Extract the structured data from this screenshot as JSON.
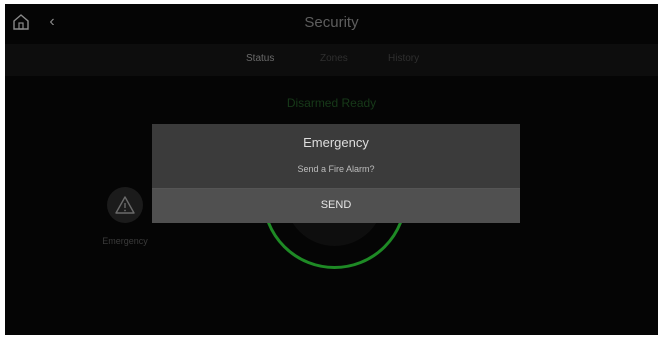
{
  "header": {
    "title": "Security",
    "home_icon": "home-icon",
    "back_icon": "chevron-left-icon"
  },
  "tabs": [
    {
      "label": "Status",
      "active": true
    },
    {
      "label": "Zones",
      "active": false
    },
    {
      "label": "History",
      "active": false
    }
  ],
  "status": {
    "arm_state": "Disarmed Ready"
  },
  "emergency": {
    "label": "Emergency",
    "icon": "warning-icon"
  },
  "dialog": {
    "title": "Emergency",
    "message": "Send a Fire Alarm?",
    "action_label": "SEND"
  },
  "colors": {
    "screen_bg": "#050505",
    "ring_accent": "#1e8a25",
    "dialog_bg": "#3b3b3b",
    "dialog_action_bg": "#505050"
  }
}
